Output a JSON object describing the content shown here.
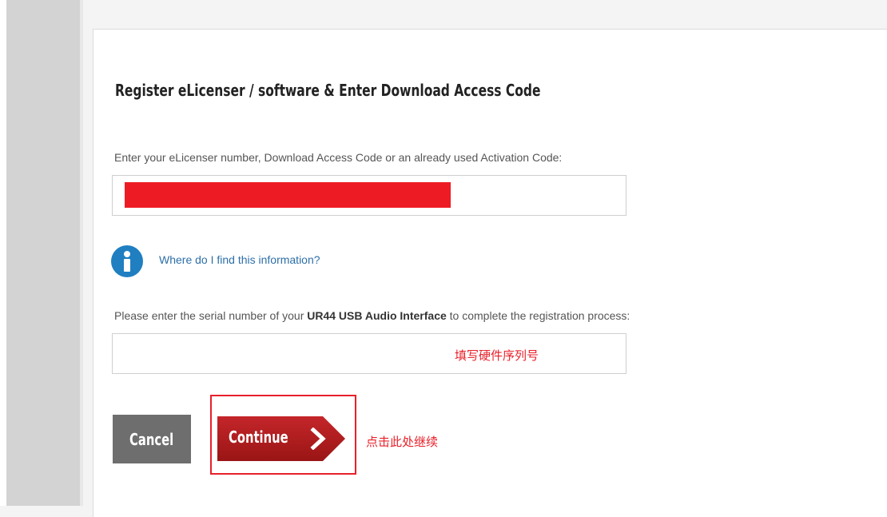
{
  "form": {
    "heading": "Register eLicenser / software & Enter Download Access Code",
    "code_label": "Enter your eLicenser number, Download Access Code or an already used Activation Code:",
    "info_link": "Where do I find this information?",
    "serial_label_pre": "Please enter the serial number of your ",
    "serial_label_product": "UR44 USB Audio Interface",
    "serial_label_post": " to complete the registration process:",
    "serial_annotation": "填写硬件序列号"
  },
  "buttons": {
    "cancel": "Cancel",
    "continue": "Continue",
    "continue_annotation": "点击此处继续"
  },
  "colors": {
    "redaction": "#ed1c24",
    "annotation_red": "#e8202a",
    "info_blue": "#1f7fc1",
    "cancel_gray": "#6e6e6e",
    "continue_dark_red": "#b31b1b"
  },
  "icons": {
    "info": "info-circle-icon",
    "continue_arrow": "chevron-right-icon"
  }
}
